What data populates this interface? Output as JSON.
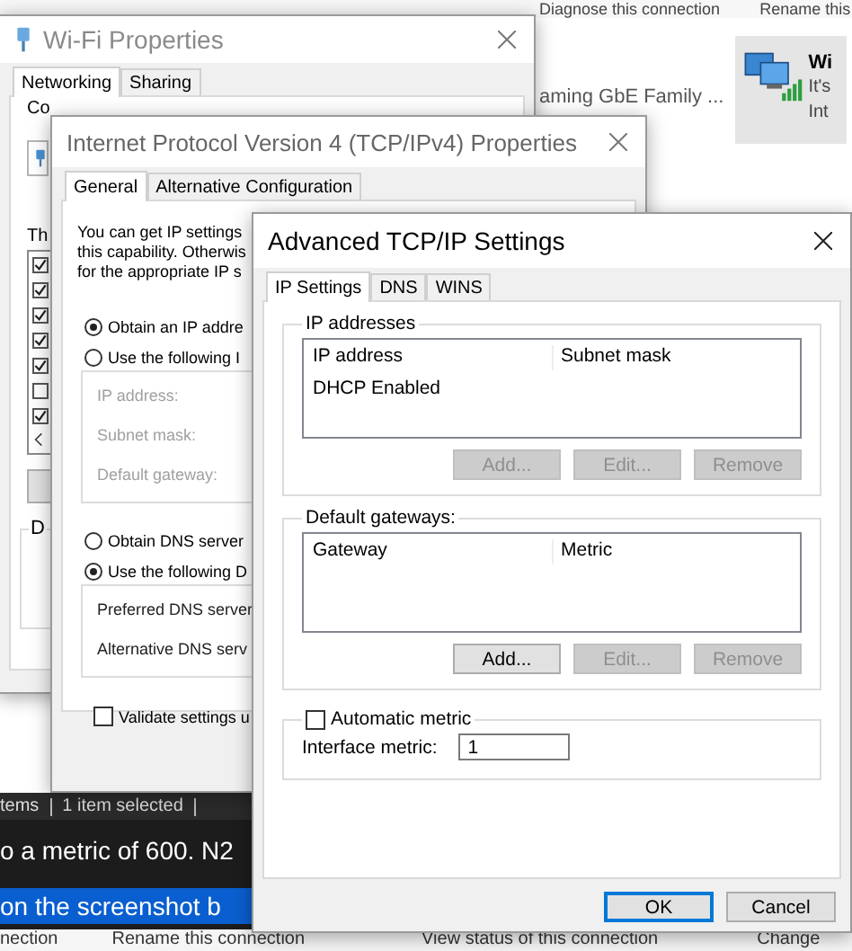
{
  "background": {
    "toolbar": [
      "Diagnose this connection",
      "Rename this"
    ],
    "adapter_detail": "aming GbE Family ...",
    "tile": {
      "name": "Wi",
      "lines": [
        "It's",
        "Int"
      ]
    },
    "status_bar": [
      "tems",
      "1 item selected"
    ],
    "caption_lines": [
      {
        "text": "o a metric of 600. N2",
        "kind": "plain"
      },
      {
        "text": "on the screenshot b",
        "kind": "highlight"
      }
    ],
    "bottom_toolbar": [
      "nection",
      "Rename this connection",
      "View status of this connection",
      "Change"
    ]
  },
  "wifi_window": {
    "title": "Wi-Fi Properties",
    "tabs": [
      {
        "label": "Networking",
        "selected": true
      },
      {
        "label": "Sharing",
        "selected": false
      }
    ],
    "connect_label": "Co",
    "list_label": "Th",
    "group_label": "D",
    "components": [
      {
        "checked": true
      },
      {
        "checked": true
      },
      {
        "checked": true
      },
      {
        "checked": true
      },
      {
        "checked": true
      },
      {
        "checked": false
      },
      {
        "checked": true
      }
    ]
  },
  "ipv4_window": {
    "title": "Internet Protocol Version 4 (TCP/IPv4) Properties",
    "tabs": [
      {
        "label": "General",
        "selected": true
      },
      {
        "label": "Alternative Configuration",
        "selected": false
      }
    ],
    "intro_lines": [
      "You can get IP settings",
      "this capability. Otherwis",
      "for the appropriate IP s"
    ],
    "ip_mode": [
      {
        "label": "Obtain an IP addre",
        "selected": true
      },
      {
        "label": "Use the following I",
        "selected": false
      }
    ],
    "ip_fields": [
      {
        "label": "IP address:",
        "disabled": true
      },
      {
        "label": "Subnet mask:",
        "disabled": true
      },
      {
        "label": "Default gateway:",
        "disabled": true
      }
    ],
    "dns_mode": [
      {
        "label": "Obtain DNS server",
        "selected": false
      },
      {
        "label": "Use the following D",
        "selected": true
      }
    ],
    "dns_fields": [
      {
        "label": "Preferred DNS server",
        "disabled": false
      },
      {
        "label": "Alternative DNS serv",
        "disabled": false
      }
    ],
    "validate": {
      "label": "Validate settings u",
      "checked": false
    }
  },
  "advanced_window": {
    "title": "Advanced TCP/IP Settings",
    "tabs": [
      {
        "label": "IP Settings",
        "selected": true
      },
      {
        "label": "DNS",
        "selected": false
      },
      {
        "label": "WINS",
        "selected": false
      }
    ],
    "groups": [
      {
        "title": "IP addresses",
        "columns": [
          "IP address",
          "Subnet mask"
        ],
        "rows": [
          [
            "DHCP Enabled"
          ]
        ],
        "buttons": [
          {
            "label": "Add...",
            "disabled": true
          },
          {
            "label": "Edit...",
            "disabled": true
          },
          {
            "label": "Remove",
            "disabled": true
          }
        ]
      },
      {
        "title": "Default gateways:",
        "columns": [
          "Gateway",
          "Metric"
        ],
        "buttons": [
          {
            "label": "Add...",
            "disabled": false
          },
          {
            "label": "Edit...",
            "disabled": true
          },
          {
            "label": "Remove",
            "disabled": true
          }
        ]
      }
    ],
    "automatic_metric": {
      "label": "Automatic metric",
      "checked": false
    },
    "interface_metric": {
      "label": "Interface metric:",
      "value": "1"
    },
    "buttons": [
      {
        "label": "OK",
        "default": true
      },
      {
        "label": "Cancel",
        "default": false
      }
    ]
  }
}
